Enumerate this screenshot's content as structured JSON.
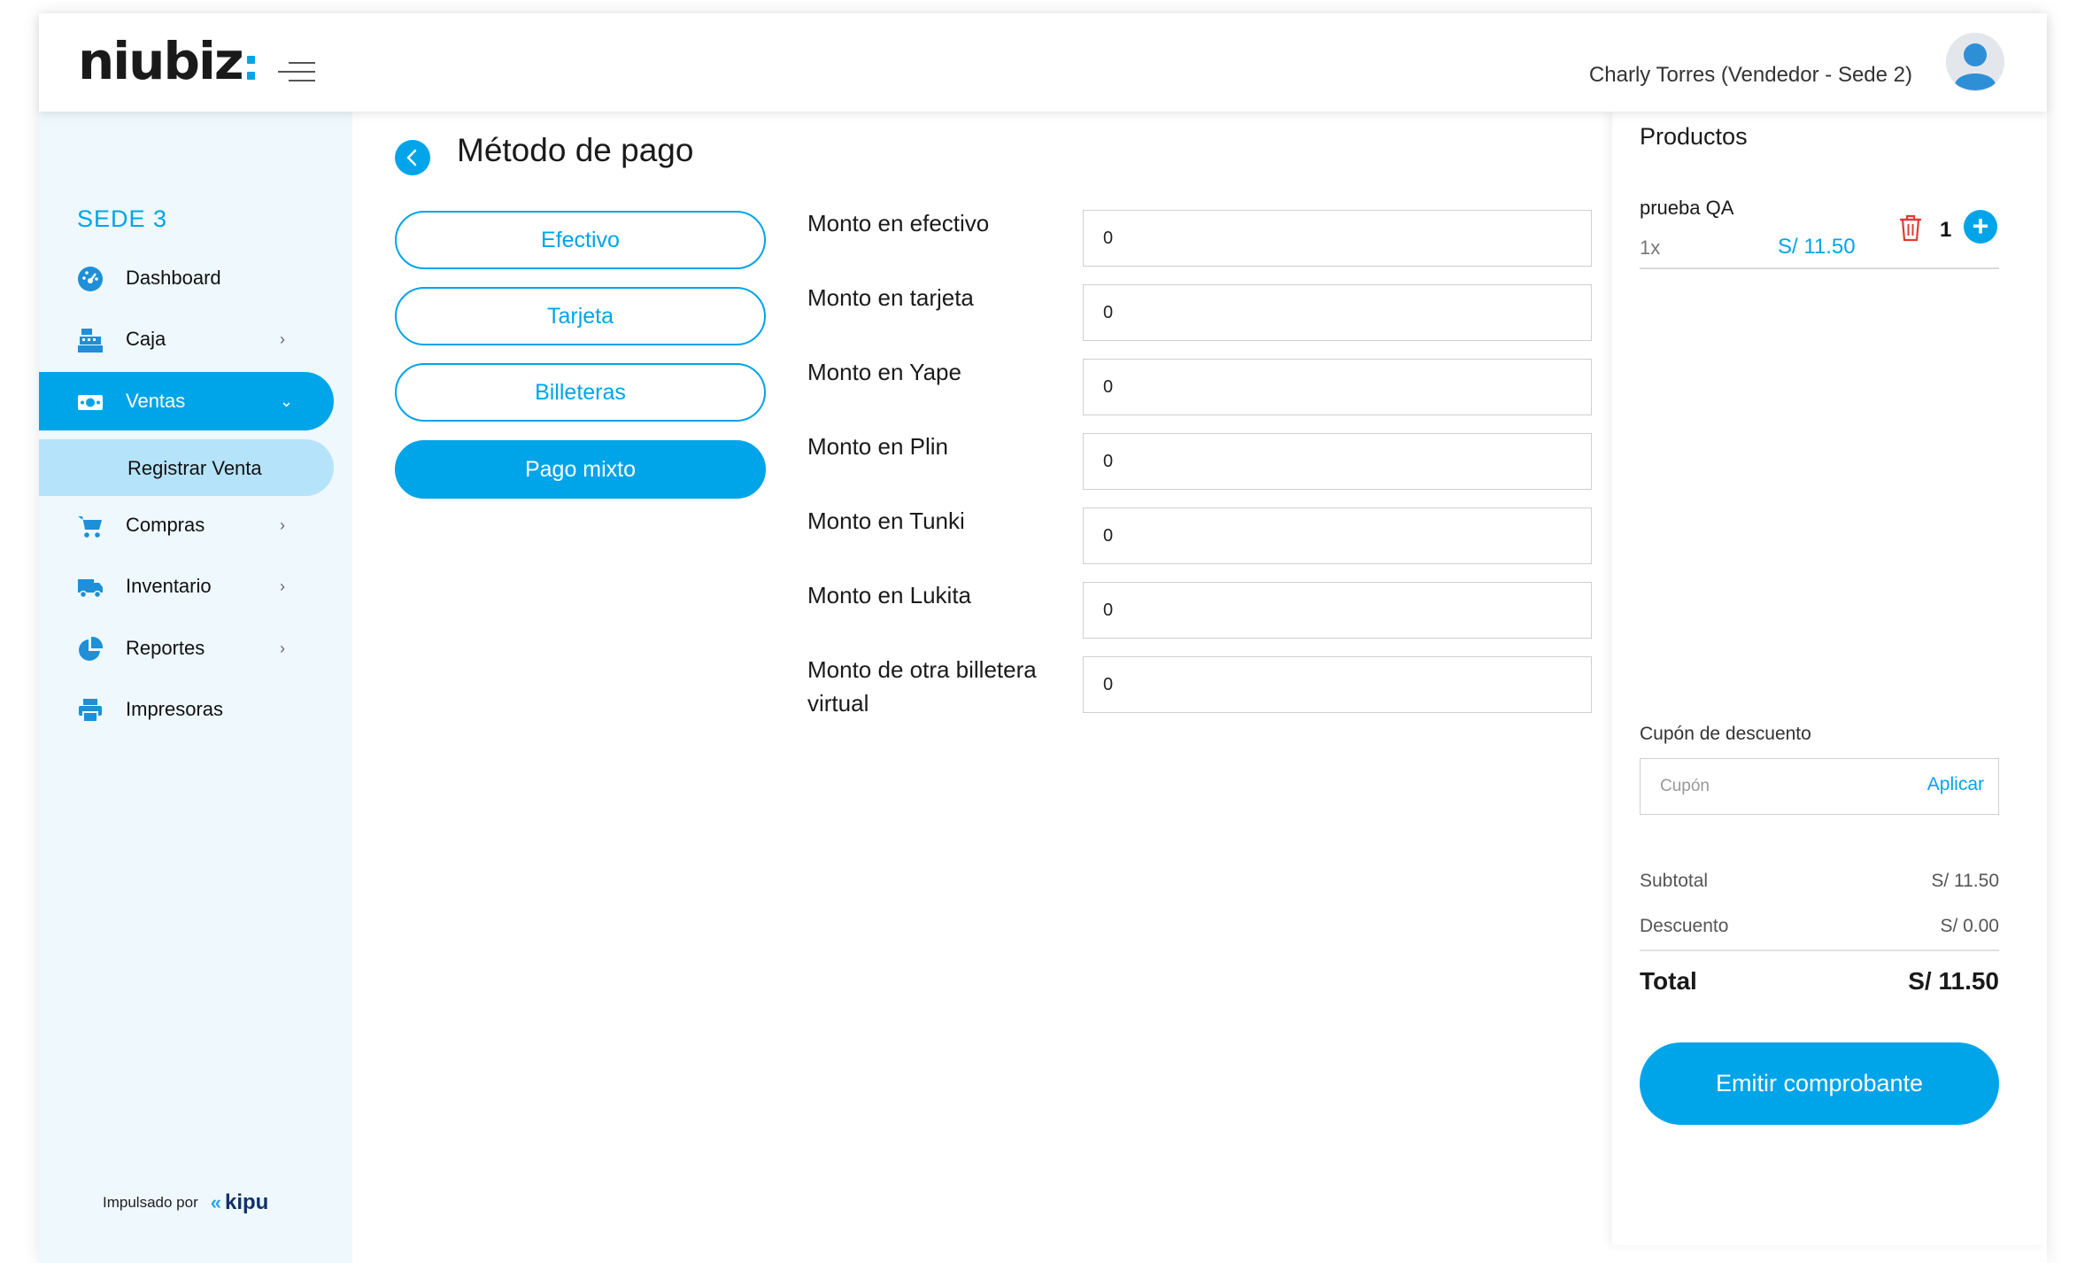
{
  "header": {
    "brand": "niubiz",
    "user_label": "Charly Torres (Vendedor - Sede 2)"
  },
  "sidebar": {
    "sede": "SEDE 3",
    "items": [
      {
        "label": "Dashboard",
        "icon": "dashboard-icon"
      },
      {
        "label": "Caja",
        "icon": "cash-register-icon",
        "chevron": "›"
      },
      {
        "label": "Ventas",
        "icon": "money-icon",
        "chevron": "⌄",
        "active": true
      },
      {
        "label": "Compras",
        "icon": "cart-icon",
        "chevron": "›"
      },
      {
        "label": "Inventario",
        "icon": "truck-icon",
        "chevron": "›"
      },
      {
        "label": "Reportes",
        "icon": "pie-chart-icon",
        "chevron": "›"
      },
      {
        "label": "Impresoras",
        "icon": "printer-icon"
      }
    ],
    "sub_item": "Registrar Venta",
    "powered_by": "Impulsado por",
    "powered_brand": "kipu"
  },
  "main": {
    "title": "Método de pago",
    "methods": [
      {
        "label": "Efectivo",
        "selected": false
      },
      {
        "label": "Tarjeta",
        "selected": false
      },
      {
        "label": "Billeteras",
        "selected": false
      },
      {
        "label": "Pago mixto",
        "selected": true
      }
    ],
    "fields": [
      {
        "label": "Monto en efectivo",
        "value": "0"
      },
      {
        "label": "Monto en tarjeta",
        "value": "0"
      },
      {
        "label": "Monto en Yape",
        "value": "0"
      },
      {
        "label": "Monto en Plin",
        "value": "0"
      },
      {
        "label": "Monto en Tunki",
        "value": "0"
      },
      {
        "label": "Monto en Lukita",
        "value": "0"
      },
      {
        "label": "Monto de otra billetera virtual",
        "value": "0"
      }
    ]
  },
  "cart": {
    "title": "Productos",
    "product": {
      "name": "prueba QA",
      "qty_text": "1x",
      "price": "S/ 11.50",
      "count": "1"
    },
    "coupon_label": "Cupón de descuento",
    "coupon_placeholder": "Cupón",
    "apply_label": "Aplicar",
    "subtotal_label": "Subtotal",
    "subtotal_value": "S/ 11.50",
    "discount_label": "Descuento",
    "discount_value": "S/ 0.00",
    "total_label": "Total",
    "total_value": "S/ 11.50",
    "emit_label": "Emitir comprobante"
  },
  "colors": {
    "accent": "#00a4e8",
    "sidebar_bg": "#eef8fd",
    "sub_active": "#b5e3fa",
    "danger": "#e53935"
  }
}
